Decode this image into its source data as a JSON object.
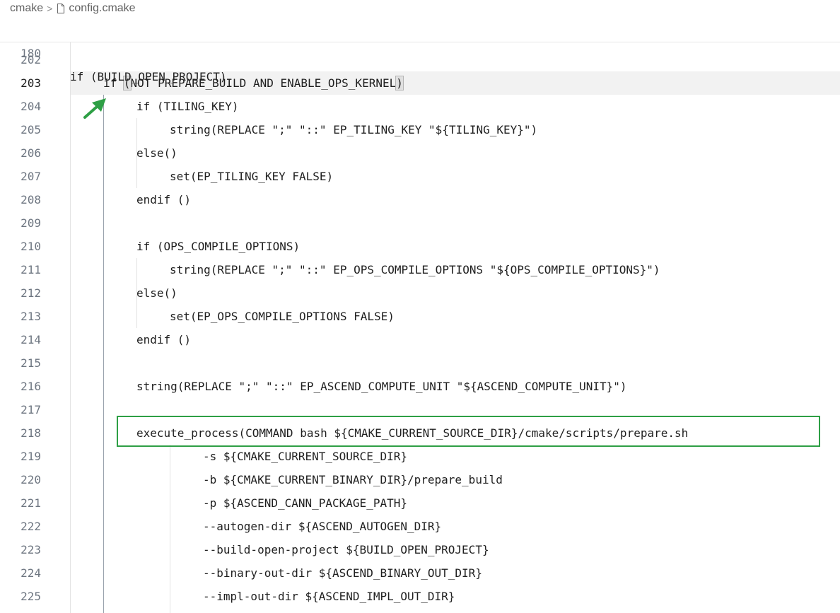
{
  "breadcrumb": {
    "folder": "cmake",
    "separator": ">",
    "file": "config.cmake",
    "file_icon": "file-icon"
  },
  "sticky": {
    "line_number": "180",
    "text": "if (BUILD_OPEN_PROJECT)"
  },
  "current_line": "203",
  "annotation": {
    "arrow_color": "#2e9f45",
    "box_color": "#2e9f45",
    "box_line": "218"
  },
  "lines": [
    {
      "n": "202",
      "text": ""
    },
    {
      "n": "203",
      "text": "if (NOT PREPARE_BUILD AND ENABLE_OPS_KERNEL)"
    },
    {
      "n": "204",
      "text": "if (TILING_KEY)"
    },
    {
      "n": "205",
      "text": "string(REPLACE \";\" \"::\" EP_TILING_KEY \"${TILING_KEY}\")"
    },
    {
      "n": "206",
      "text": "else()"
    },
    {
      "n": "207",
      "text": "set(EP_TILING_KEY FALSE)"
    },
    {
      "n": "208",
      "text": "endif ()"
    },
    {
      "n": "209",
      "text": ""
    },
    {
      "n": "210",
      "text": "if (OPS_COMPILE_OPTIONS)"
    },
    {
      "n": "211",
      "text": "string(REPLACE \";\" \"::\" EP_OPS_COMPILE_OPTIONS \"${OPS_COMPILE_OPTIONS}\")"
    },
    {
      "n": "212",
      "text": "else()"
    },
    {
      "n": "213",
      "text": "set(EP_OPS_COMPILE_OPTIONS FALSE)"
    },
    {
      "n": "214",
      "text": "endif ()"
    },
    {
      "n": "215",
      "text": ""
    },
    {
      "n": "216",
      "text": "string(REPLACE \";\" \"::\" EP_ASCEND_COMPUTE_UNIT \"${ASCEND_COMPUTE_UNIT}\")"
    },
    {
      "n": "217",
      "text": ""
    },
    {
      "n": "218",
      "text": "execute_process(COMMAND bash ${CMAKE_CURRENT_SOURCE_DIR}/cmake/scripts/prepare.sh"
    },
    {
      "n": "219",
      "text": "-s ${CMAKE_CURRENT_SOURCE_DIR}"
    },
    {
      "n": "220",
      "text": "-b ${CMAKE_CURRENT_BINARY_DIR}/prepare_build"
    },
    {
      "n": "221",
      "text": "-p ${ASCEND_CANN_PACKAGE_PATH}"
    },
    {
      "n": "222",
      "text": "--autogen-dir ${ASCEND_AUTOGEN_DIR}"
    },
    {
      "n": "223",
      "text": "--build-open-project ${BUILD_OPEN_PROJECT}"
    },
    {
      "n": "224",
      "text": "--binary-out-dir ${ASCEND_BINARY_OUT_DIR}"
    },
    {
      "n": "225",
      "text": "--impl-out-dir ${ASCEND_IMPL_OUT_DIR}"
    }
  ]
}
